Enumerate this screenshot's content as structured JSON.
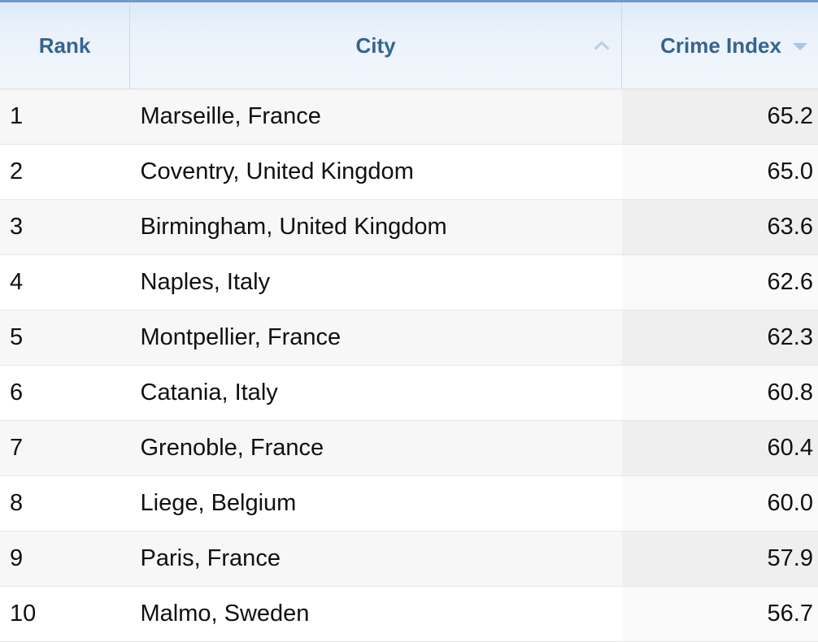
{
  "table": {
    "columns": [
      {
        "key": "rank",
        "label": "Rank",
        "align": "left",
        "sort_icon": "none"
      },
      {
        "key": "city",
        "label": "City",
        "align": "left",
        "sort_icon": "chevron-up-icon"
      },
      {
        "key": "index",
        "label": "Crime Index",
        "align": "right",
        "sort_icon": "triangle-down-icon"
      }
    ],
    "header": {
      "rank_label": "Rank",
      "city_label": "City",
      "crime_index_label": "Crime Index",
      "crime_index_line1": "Crime",
      "crime_index_line2": "Index"
    },
    "sort": {
      "active_column": "Crime Index",
      "direction": "descending"
    },
    "rows": [
      {
        "rank": "1",
        "city": "Marseille, France",
        "index": "65.2"
      },
      {
        "rank": "2",
        "city": "Coventry, United Kingdom",
        "index": "65.0"
      },
      {
        "rank": "3",
        "city": "Birmingham, United Kingdom",
        "index": "63.6"
      },
      {
        "rank": "4",
        "city": "Naples, Italy",
        "index": "62.6"
      },
      {
        "rank": "5",
        "city": "Montpellier, France",
        "index": "62.3"
      },
      {
        "rank": "6",
        "city": "Catania, Italy",
        "index": "60.8"
      },
      {
        "rank": "7",
        "city": "Grenoble, France",
        "index": "60.4"
      },
      {
        "rank": "8",
        "city": "Liege, Belgium",
        "index": "60.0"
      },
      {
        "rank": "9",
        "city": "Paris, France",
        "index": "57.9"
      },
      {
        "rank": "10",
        "city": "Malmo, Sweden",
        "index": "56.7"
      }
    ]
  },
  "colors": {
    "header_text": "#36648f",
    "header_top_border": "#6f9bc8",
    "header_bg_top": "#dce9f7",
    "header_bg_bottom": "#f2f6fc",
    "sort_icon_active": "#a9c8e4",
    "sort_icon_inactive": "#bcd2e6",
    "row_odd_bg": "#f7f7f7",
    "row_even_bg": "#ffffff",
    "sorted_col_odd_bg": "#efefef",
    "sorted_col_even_bg": "#fafafa",
    "row_border": "#e6e6e6",
    "body_text": "#101010"
  }
}
